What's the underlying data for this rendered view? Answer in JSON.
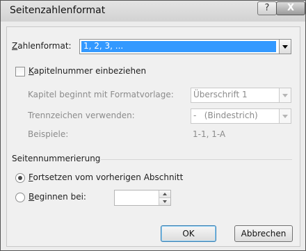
{
  "window": {
    "title": "Seitenzahlenformat"
  },
  "titlebar": {
    "help_label": "?",
    "close_label": "X"
  },
  "zahlenformat": {
    "label_accel": "Z",
    "label_rest": "ahlenformat:",
    "value": "1, 2, 3, ..."
  },
  "kapitel": {
    "checkbox_accel": "K",
    "checkbox_rest": "apitelnummer einbeziehen",
    "checked": false,
    "style_label": "Kapitel beginnt mit Formatvorlage:",
    "style_value": "Überschrift 1",
    "separator_label": "Trennzeichen verwenden:",
    "separator_value": "-   (Bindestrich)",
    "example_label": "Beispiele:",
    "example_value": "1-1, 1-A"
  },
  "seitennummerierung": {
    "group_label": "Seitennummerierung",
    "continue_accel": "F",
    "continue_rest": "ortsetzen vom vorherigen Abschnitt",
    "start_accel": "B",
    "start_rest": "eginnen bei:",
    "start_value": "",
    "selected": "continue"
  },
  "buttons": {
    "ok": "OK",
    "cancel": "Abbrechen"
  },
  "colors": {
    "selection": "#3399ff",
    "disabled_text": "#8b8b8b"
  }
}
